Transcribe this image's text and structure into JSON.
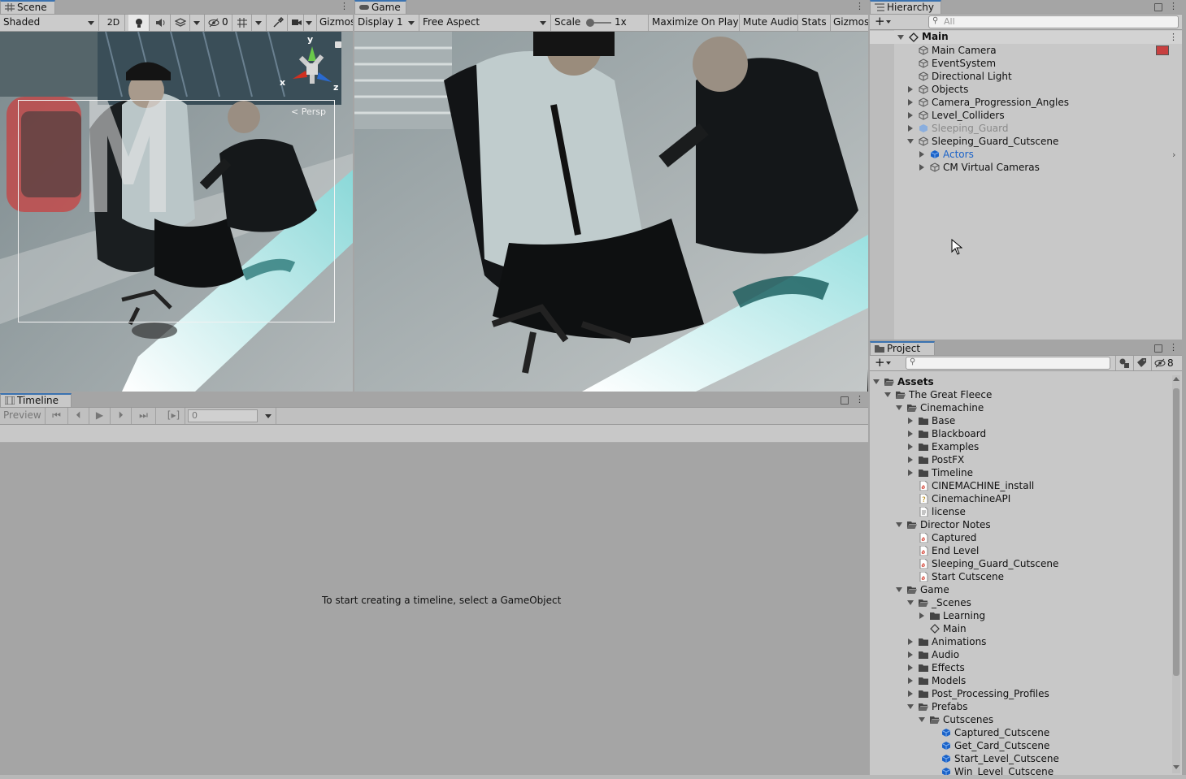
{
  "scene": {
    "tab": "Scene",
    "toolbar": {
      "shading": "Shaded",
      "mode_2d": "2D",
      "hidden_count": "0",
      "gizmos": "Gizmos"
    },
    "persp_label": "< Persp",
    "axis": {
      "x": "x",
      "y": "y",
      "z": "z"
    }
  },
  "game": {
    "tab": "Game",
    "toolbar": {
      "display": "Display 1",
      "aspect": "Free Aspect",
      "scale_label": "Scale",
      "scale_value": "1x",
      "maximize": "Maximize On Play",
      "mute": "Mute Audio",
      "stats": "Stats",
      "gizmos": "Gizmos"
    }
  },
  "hierarchy": {
    "tab": "Hierarchy",
    "search_placeholder": "All",
    "scene_name": "Main",
    "items": [
      {
        "label": "Main Camera",
        "depth": 1,
        "expander": "none",
        "icon": "gameobject"
      },
      {
        "label": "EventSystem",
        "depth": 1,
        "expander": "none",
        "icon": "gameobject"
      },
      {
        "label": "Directional Light",
        "depth": 1,
        "expander": "none",
        "icon": "gameobject"
      },
      {
        "label": "Objects",
        "depth": 1,
        "expander": "closed",
        "icon": "gameobject"
      },
      {
        "label": "Camera_Progression_Angles",
        "depth": 1,
        "expander": "closed",
        "icon": "gameobject"
      },
      {
        "label": "Level_Colliders",
        "depth": 1,
        "expander": "closed",
        "icon": "gameobject"
      },
      {
        "label": "Sleeping_Guard",
        "depth": 1,
        "expander": "closed",
        "icon": "prefab-faded",
        "faded": true
      },
      {
        "label": "Sleeping_Guard_Cutscene",
        "depth": 1,
        "expander": "open",
        "icon": "gameobject"
      },
      {
        "label": "Actors",
        "depth": 2,
        "expander": "closed",
        "icon": "prefab",
        "prefab": true
      },
      {
        "label": "CM Virtual Cameras",
        "depth": 2,
        "expander": "closed",
        "icon": "gameobject"
      }
    ]
  },
  "timeline": {
    "tab": "Timeline",
    "preview_label": "Preview",
    "frame_value": "0",
    "empty_message": "To start creating a timeline, select a GameObject"
  },
  "project": {
    "tab": "Project",
    "hidden_count": "8",
    "items": [
      {
        "label": "Assets",
        "depth": 0,
        "expander": "open",
        "icon": "folder-open",
        "bold": true
      },
      {
        "label": "The Great Fleece",
        "depth": 1,
        "expander": "open",
        "icon": "folder-open"
      },
      {
        "label": "Cinemachine",
        "depth": 2,
        "expander": "open",
        "icon": "folder-open"
      },
      {
        "label": "Base",
        "depth": 3,
        "expander": "closed",
        "icon": "folder"
      },
      {
        "label": "Blackboard",
        "depth": 3,
        "expander": "closed",
        "icon": "folder"
      },
      {
        "label": "Examples",
        "depth": 3,
        "expander": "closed",
        "icon": "folder"
      },
      {
        "label": "PostFX",
        "depth": 3,
        "expander": "closed",
        "icon": "folder"
      },
      {
        "label": "Timeline",
        "depth": 3,
        "expander": "closed",
        "icon": "folder"
      },
      {
        "label": "CINEMACHINE_install",
        "depth": 3,
        "expander": "none",
        "icon": "pdf"
      },
      {
        "label": "CinemachineAPI",
        "depth": 3,
        "expander": "none",
        "icon": "help"
      },
      {
        "label": "license",
        "depth": 3,
        "expander": "none",
        "icon": "text"
      },
      {
        "label": "Director Notes",
        "depth": 2,
        "expander": "open",
        "icon": "folder-open"
      },
      {
        "label": "Captured",
        "depth": 3,
        "expander": "none",
        "icon": "pdf"
      },
      {
        "label": "End Level",
        "depth": 3,
        "expander": "none",
        "icon": "pdf"
      },
      {
        "label": "Sleeping_Guard_Cutscene",
        "depth": 3,
        "expander": "none",
        "icon": "pdf"
      },
      {
        "label": "Start Cutscene",
        "depth": 3,
        "expander": "none",
        "icon": "pdf"
      },
      {
        "label": "Game",
        "depth": 2,
        "expander": "open",
        "icon": "folder-open"
      },
      {
        "label": "_Scenes",
        "depth": 3,
        "expander": "open",
        "icon": "folder-open"
      },
      {
        "label": "Learning",
        "depth": 4,
        "expander": "closed",
        "icon": "folder"
      },
      {
        "label": "Main",
        "depth": 4,
        "expander": "none",
        "icon": "scene"
      },
      {
        "label": "Animations",
        "depth": 3,
        "expander": "closed",
        "icon": "folder"
      },
      {
        "label": "Audio",
        "depth": 3,
        "expander": "closed",
        "icon": "folder"
      },
      {
        "label": "Effects",
        "depth": 3,
        "expander": "closed",
        "icon": "folder"
      },
      {
        "label": "Models",
        "depth": 3,
        "expander": "closed",
        "icon": "folder"
      },
      {
        "label": "Post_Processing_Profiles",
        "depth": 3,
        "expander": "closed",
        "icon": "folder"
      },
      {
        "label": "Prefabs",
        "depth": 3,
        "expander": "open",
        "icon": "folder-open"
      },
      {
        "label": "Cutscenes",
        "depth": 4,
        "expander": "open",
        "icon": "folder-open"
      },
      {
        "label": "Captured_Cutscene",
        "depth": 5,
        "expander": "none",
        "icon": "prefab"
      },
      {
        "label": "Get_Card_Cutscene",
        "depth": 5,
        "expander": "none",
        "icon": "prefab"
      },
      {
        "label": "Start_Level_Cutscene",
        "depth": 5,
        "expander": "none",
        "icon": "prefab"
      },
      {
        "label": "Win_Level_Cutscene",
        "depth": 5,
        "expander": "none",
        "icon": "prefab"
      }
    ]
  },
  "colors": {
    "selected_tab": "#3a72b0",
    "prefab_blue": "#1a62c8",
    "pdf_red": "#d03020"
  }
}
